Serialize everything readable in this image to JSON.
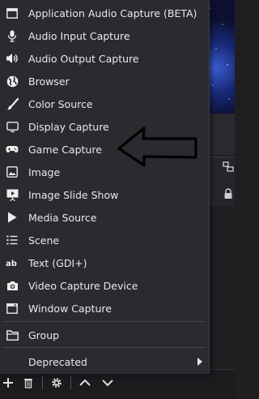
{
  "menu": {
    "items": [
      {
        "label": "Application Audio Capture (BETA)",
        "icon": "window-icon"
      },
      {
        "label": "Audio Input Capture",
        "icon": "microphone-icon"
      },
      {
        "label": "Audio Output Capture",
        "icon": "speaker-icon"
      },
      {
        "label": "Browser",
        "icon": "globe-icon"
      },
      {
        "label": "Color Source",
        "icon": "paintbrush-icon"
      },
      {
        "label": "Display Capture",
        "icon": "monitor-icon"
      },
      {
        "label": "Game Capture",
        "icon": "gamepad-icon"
      },
      {
        "label": "Image",
        "icon": "image-icon"
      },
      {
        "label": "Image Slide Show",
        "icon": "slideshow-icon"
      },
      {
        "label": "Media Source",
        "icon": "play-icon"
      },
      {
        "label": "Scene",
        "icon": "list-icon"
      },
      {
        "label": "Text (GDI+)",
        "icon": "text-icon"
      },
      {
        "label": "Video Capture Device",
        "icon": "camera-icon"
      },
      {
        "label": "Window Capture",
        "icon": "window-icon"
      }
    ],
    "group": {
      "label": "Group",
      "icon": "folder-icon"
    },
    "deprecated": {
      "label": "Deprecated",
      "icon": "chevron-right-icon"
    }
  },
  "bottom_toolbar": {
    "icons": [
      "add-icon",
      "trash-icon",
      "gear-icon",
      "chevron-up-icon",
      "chevron-down-icon"
    ]
  },
  "colors": {
    "menu_bg": "#2b2b2f",
    "text": "#e9e9e9",
    "annotation_arrow": "#000000"
  }
}
